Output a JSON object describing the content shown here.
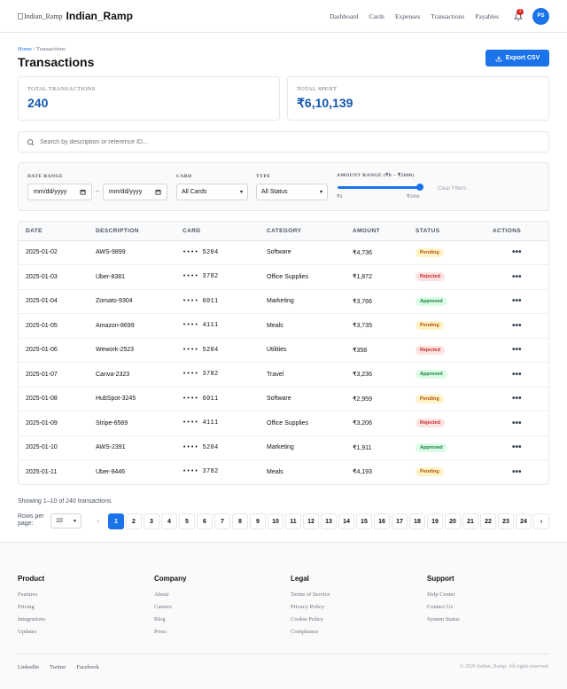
{
  "header": {
    "logo_alt": "Indian_Ramp",
    "brand": "Indian_Ramp",
    "nav": [
      "Dashboard",
      "Cards",
      "Expenses",
      "Transactions",
      "Payables"
    ],
    "notification_count": "3",
    "avatar_initials": "PS"
  },
  "breadcrumb": {
    "home": "Home",
    "sep": " / ",
    "current": "Transactions"
  },
  "page_title": "Transactions",
  "export_label": "Export CSV",
  "stats": [
    {
      "label": "TOTAL TRANSACTIONS",
      "value": "240"
    },
    {
      "label": "TOTAL SPENT",
      "value": "₹6,10,139"
    }
  ],
  "search": {
    "placeholder": "Search by description or reference ID..."
  },
  "filters": {
    "date_label": "DATE RANGE",
    "date_from": "mm/dd/yyyy",
    "date_sep": "–",
    "date_to": "mm/dd/yyyy",
    "card_label": "CARD",
    "card_value": "All Cards",
    "type_label": "TYPE",
    "type_value": "All Status",
    "amount_label": "AMOUNT RANGE (₹0 – ₹5000)",
    "amount_min": "₹0",
    "amount_max": "₹5000",
    "clear_label": "Clear Filters"
  },
  "table": {
    "columns": [
      "DATE",
      "DESCRIPTION",
      "CARD",
      "CATEGORY",
      "AMOUNT",
      "STATUS",
      "ACTIONS"
    ],
    "rows": [
      {
        "date": "2025-01-02",
        "desc": "AWS-9899",
        "card": "•••• 5204",
        "category": "Software",
        "amount": "₹4,736",
        "status": "Pending"
      },
      {
        "date": "2025-01-03",
        "desc": "Uber-8381",
        "card": "•••• 3782",
        "category": "Office Supplies",
        "amount": "₹1,872",
        "status": "Rejected"
      },
      {
        "date": "2025-01-04",
        "desc": "Zomato-9304",
        "card": "•••• 6011",
        "category": "Marketing",
        "amount": "₹3,766",
        "status": "Approved"
      },
      {
        "date": "2025-01-05",
        "desc": "Amazon-8699",
        "card": "•••• 4111",
        "category": "Meals",
        "amount": "₹3,735",
        "status": "Pending"
      },
      {
        "date": "2025-01-06",
        "desc": "Wework-2523",
        "card": "•••• 5204",
        "category": "Utilities",
        "amount": "₹358",
        "status": "Rejected"
      },
      {
        "date": "2025-01-07",
        "desc": "Canva-2323",
        "card": "•••• 3782",
        "category": "Travel",
        "amount": "₹3,236",
        "status": "Approved"
      },
      {
        "date": "2025-01-08",
        "desc": "HubSpot-3245",
        "card": "•••• 6011",
        "category": "Software",
        "amount": "₹2,959",
        "status": "Pending"
      },
      {
        "date": "2025-01-09",
        "desc": "Stripe-6569",
        "card": "•••• 4111",
        "category": "Office Supplies",
        "amount": "₹3,206",
        "status": "Rejected"
      },
      {
        "date": "2025-01-10",
        "desc": "AWS-2391",
        "card": "•••• 5204",
        "category": "Marketing",
        "amount": "₹1,911",
        "status": "Approved"
      },
      {
        "date": "2025-01-11",
        "desc": "Uber-9446",
        "card": "•••• 3782",
        "category": "Meals",
        "amount": "₹4,193",
        "status": "Pending"
      }
    ],
    "actions_glyph": "•••"
  },
  "pagination": {
    "showing": "Showing 1–10 of 240 transactions",
    "rows_per_page_label": "Rows per page:",
    "rows_per_page_value": "10",
    "prev": "‹",
    "next": "›",
    "pages": [
      "1",
      "2",
      "3",
      "4",
      "5",
      "6",
      "7",
      "8",
      "9",
      "10",
      "11",
      "12",
      "13",
      "14",
      "15",
      "16",
      "17",
      "18",
      "19",
      "20",
      "21",
      "22",
      "23",
      "24"
    ],
    "current_page": "1"
  },
  "footer": {
    "columns": [
      {
        "title": "Product",
        "links": [
          "Features",
          "Pricing",
          "Integrations",
          "Updates"
        ]
      },
      {
        "title": "Company",
        "links": [
          "About",
          "Careers",
          "Blog",
          "Press"
        ]
      },
      {
        "title": "Legal",
        "links": [
          "Terms of Service",
          "Privacy Policy",
          "Cookie Policy",
          "Compliance"
        ]
      },
      {
        "title": "Support",
        "links": [
          "Help Center",
          "Contact Us",
          "System Status"
        ]
      }
    ],
    "social": [
      "LinkedIn",
      "Twitter",
      "Facebook"
    ],
    "copyright": "© 2026 Indian_Ramp. All rights reserved."
  },
  "colors": {
    "accent": "#1a73e8",
    "pending": "#b45309",
    "rejected": "#c62828",
    "approved": "#15803d"
  }
}
